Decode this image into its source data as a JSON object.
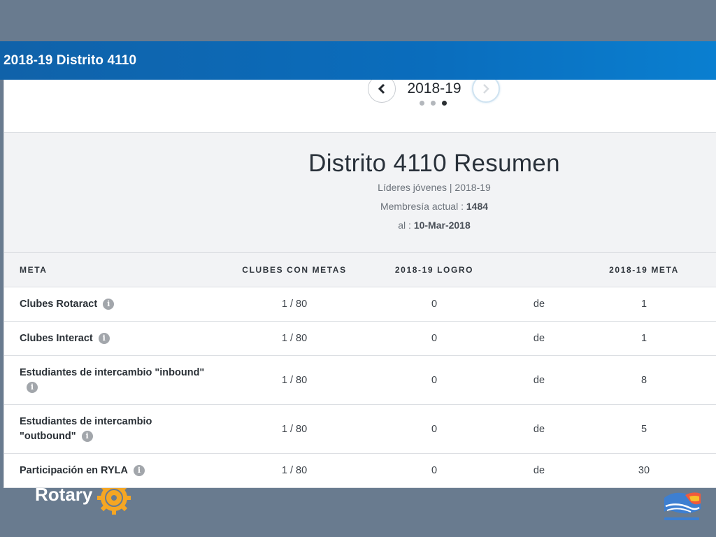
{
  "header": {
    "title": "2018-19 Distrito 4110"
  },
  "year_nav": {
    "prev_icon": "chevron-left-icon",
    "next_icon": "chevron-right-icon",
    "year": "2018-19",
    "pages": 3,
    "active_page": 3
  },
  "summary": {
    "title": "Distrito 4110 Resumen",
    "subtitle": "Líderes jóvenes | 2018-19",
    "membership_label": "Membresía actual :",
    "membership_value": "1484",
    "date_label": "al :",
    "date_value": "10-Mar-2018"
  },
  "table": {
    "columns": [
      "META",
      "CLUBES CON METAS",
      "2018-19 LOGRO",
      "",
      "2018-19 META"
    ],
    "rows": [
      {
        "meta": "Clubes Rotaract",
        "clubs": "1 / 80",
        "logro": "0",
        "de": "de",
        "goal": "1"
      },
      {
        "meta": "Clubes Interact",
        "clubs": "1 / 80",
        "logro": "0",
        "de": "de",
        "goal": "1"
      },
      {
        "meta": "Estudiantes de intercambio \"inbound\"",
        "clubs": "1 / 80",
        "logro": "0",
        "de": "de",
        "goal": "8"
      },
      {
        "meta": "Estudiantes de intercambio \"outbound\"",
        "clubs": "1 / 80",
        "logro": "0",
        "de": "de",
        "goal": "5"
      },
      {
        "meta": "Participación en RYLA",
        "clubs": "1 / 80",
        "logro": "0",
        "de": "de",
        "goal": "30"
      }
    ],
    "info_icon": "info-icon",
    "info_glyph": "i"
  },
  "footer": {
    "brand_text": "Rotary",
    "brand_icon": "rotary-wheel-icon",
    "emblem_icon": "district-emblem-icon"
  },
  "colors": {
    "header_blue": "#0a6dbd",
    "page_bg": "#697b8f",
    "rotary_gold": "#f5a623"
  }
}
